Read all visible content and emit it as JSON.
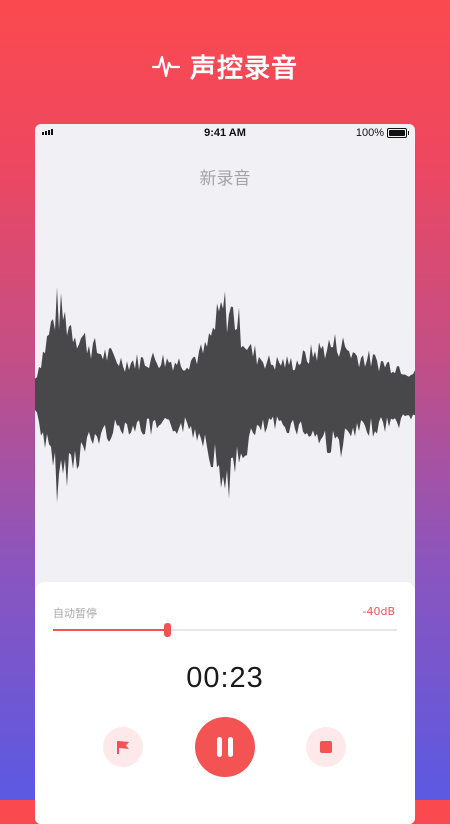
{
  "header": {
    "title": "声控录音",
    "icon": "pulse-icon"
  },
  "status_bar": {
    "time": "9:41 AM",
    "battery": "100%"
  },
  "recording": {
    "title": "新录音"
  },
  "auto_pause": {
    "label": "自动暂停",
    "threshold": "-40dB",
    "slider_fraction": 0.33
  },
  "timer": "00:23",
  "controls": {
    "flag": "flag-icon",
    "pause": "pause-icon",
    "stop": "stop-icon"
  },
  "colors": {
    "accent": "#f45354",
    "wave": "#48484a",
    "gradient_top": "#fb4a4f",
    "gradient_bottom": "#5b59e2"
  }
}
